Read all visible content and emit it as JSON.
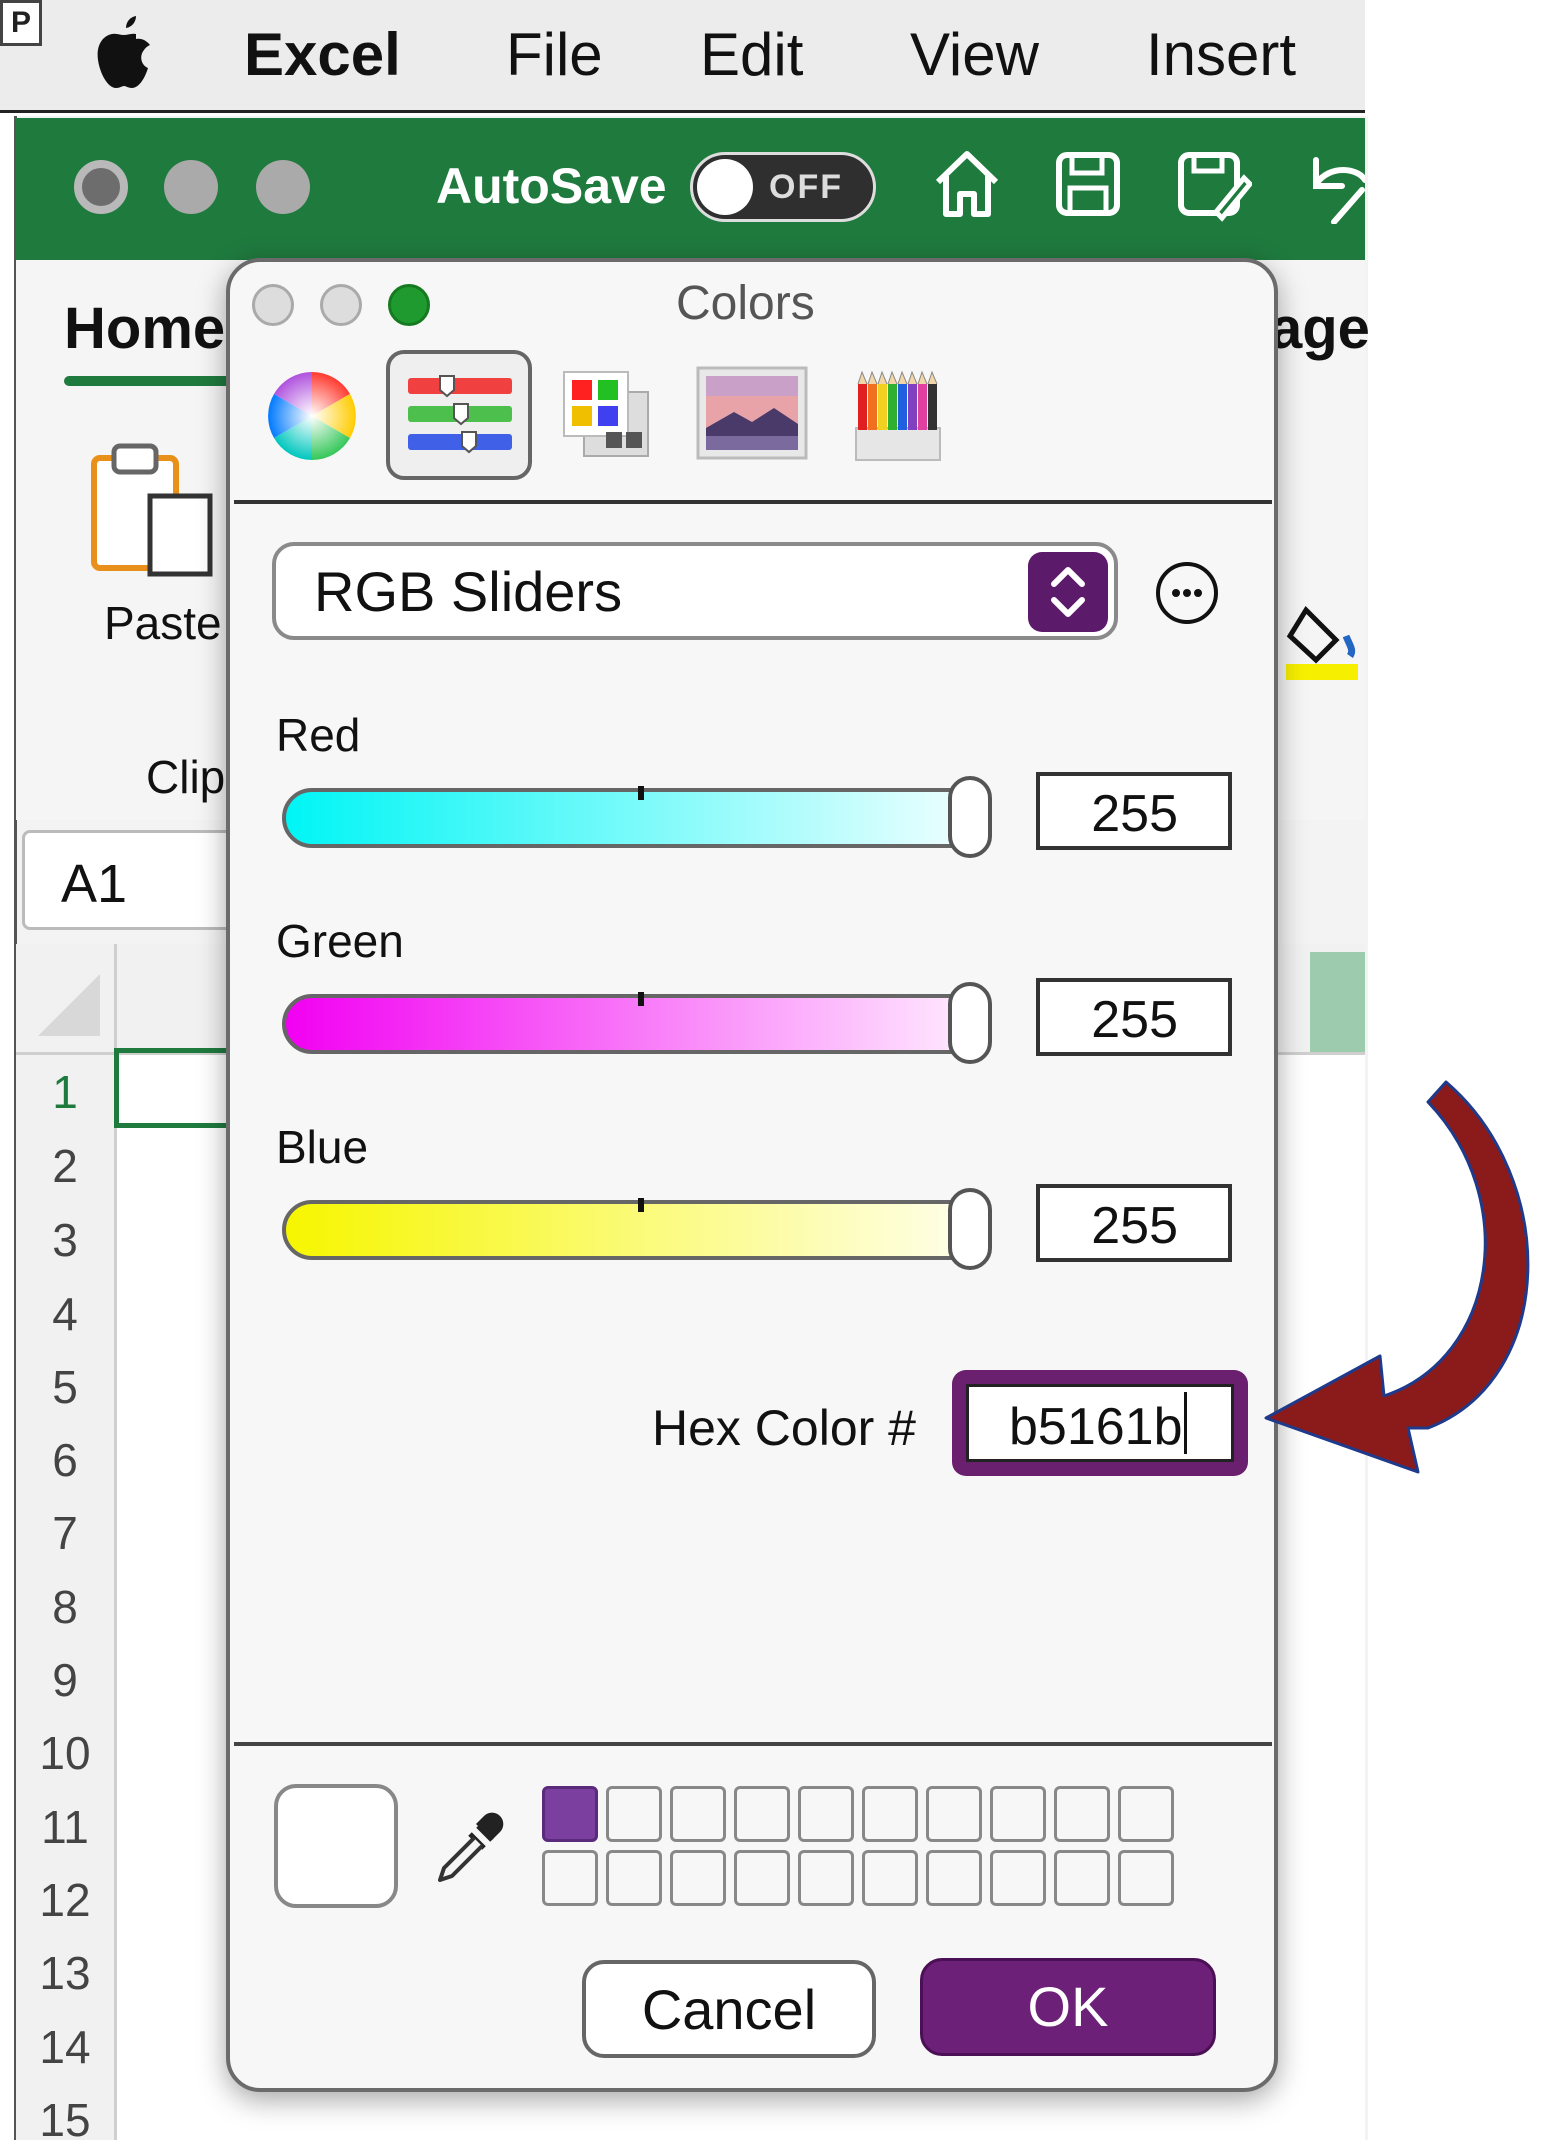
{
  "menubar": {
    "badge": "P",
    "app": "Excel",
    "items": [
      "File",
      "Edit",
      "View",
      "Insert"
    ]
  },
  "excel": {
    "autosave_label": "AutoSave",
    "autosave_state": "OFF",
    "home_tab": "Home",
    "page_tab_fragment": "age",
    "paste_label": "Paste",
    "clip_label": "Clip",
    "name_box": "A1",
    "rows": [
      "1",
      "2",
      "3",
      "4",
      "5",
      "6",
      "7",
      "8",
      "9",
      "10",
      "11",
      "12",
      "13",
      "14",
      "15"
    ],
    "accent_color": "#1f7a3e"
  },
  "dialog": {
    "title": "Colors",
    "tabs": [
      "color-wheel-icon",
      "sliders-icon",
      "palettes-icon",
      "image-palette-icon",
      "pencils-icon"
    ],
    "mode": "RGB Sliders",
    "sliders": [
      {
        "label": "Red",
        "value": "255",
        "gradient": [
          "#00f5f5",
          "#f4ffff"
        ]
      },
      {
        "label": "Green",
        "value": "255",
        "gradient": [
          "#f200f2",
          "#fff0ff"
        ]
      },
      {
        "label": "Blue",
        "value": "255",
        "gradient": [
          "#f6f600",
          "#fffff0"
        ]
      }
    ],
    "hex_label": "Hex Color #",
    "hex_value": "b5161b",
    "current_color": "#ffffff",
    "favorite_swatch": "#7b3fa0",
    "cancel_label": "Cancel",
    "ok_label": "OK",
    "accent_color": "#6c2077"
  },
  "annotation": {
    "arrow_color": "#8b1a1a"
  }
}
